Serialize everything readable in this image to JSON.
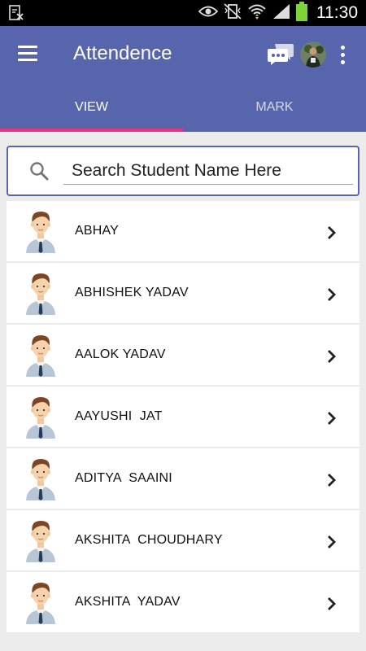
{
  "status_bar": {
    "time": "11:30",
    "icons": [
      "document-x-icon",
      "eye-icon",
      "vibrate-icon",
      "wifi-icon",
      "signal-icon",
      "battery-icon"
    ]
  },
  "app_bar": {
    "title": "Attendence",
    "background_color": "#5765ad",
    "icons": [
      "menu-icon",
      "chat-icon",
      "profile-avatar",
      "more-vert-icon"
    ]
  },
  "tabs": [
    {
      "label": "VIEW",
      "active": true
    },
    {
      "label": "MARK",
      "active": false
    }
  ],
  "tab_indicator_color": "#e8318b",
  "search": {
    "placeholder": "Search Student Name Here",
    "value": ""
  },
  "students": [
    {
      "name": "ABHAY"
    },
    {
      "name": "ABHISHEK YADAV"
    },
    {
      "name": "AALOK YADAV"
    },
    {
      "name": "AAYUSHI  JAT"
    },
    {
      "name": "ADITYA  SAAINI"
    },
    {
      "name": "AKSHITA  CHOUDHARY"
    },
    {
      "name": "AKSHITA  YADAV"
    }
  ]
}
